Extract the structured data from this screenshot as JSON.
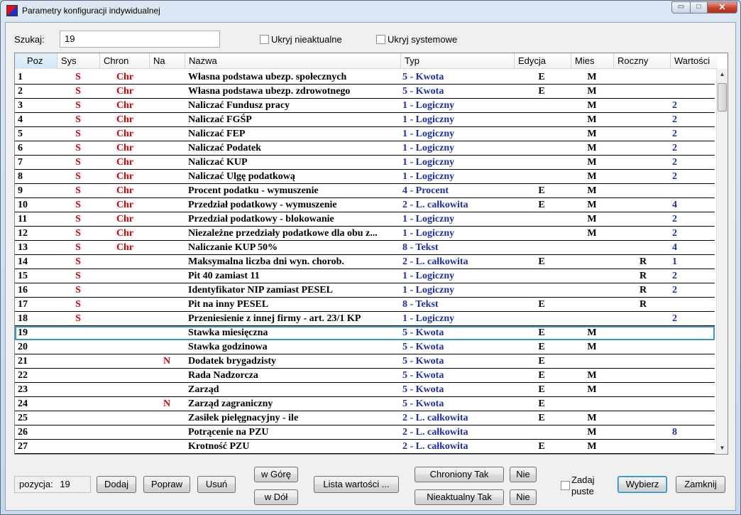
{
  "window": {
    "title": "Parametry konfiguracji indywidualnej",
    "controls": {
      "minimize": "▭",
      "maximize": "□",
      "close": "✕"
    }
  },
  "search": {
    "label": "Szukaj:",
    "value": "19"
  },
  "filters": {
    "hide_inactive": "Ukryj nieaktualne",
    "hide_system": "Ukryj systemowe"
  },
  "columns": [
    "Poz",
    "Sys",
    "Chron",
    "Na",
    "Nazwa",
    "Typ",
    "Edycja",
    "Mies",
    "Roczny",
    "Wartości"
  ],
  "rows": [
    {
      "poz": "1",
      "sys": "S",
      "chron": "Chr",
      "na": "",
      "nazwa": "Własna podstawa ubezp. społecznych",
      "typ": "5 - Kwota",
      "edycja": "E",
      "mies": "M",
      "roczny": "",
      "wart": ""
    },
    {
      "poz": "2",
      "sys": "S",
      "chron": "Chr",
      "na": "",
      "nazwa": "Własna podstawa ubezp. zdrowotnego",
      "typ": "5 - Kwota",
      "edycja": "E",
      "mies": "M",
      "roczny": "",
      "wart": ""
    },
    {
      "poz": "3",
      "sys": "S",
      "chron": "Chr",
      "na": "",
      "nazwa": "Naliczać Fundusz pracy",
      "typ": "1 - Logiczny",
      "edycja": "",
      "mies": "M",
      "roczny": "",
      "wart": "2"
    },
    {
      "poz": "4",
      "sys": "S",
      "chron": "Chr",
      "na": "",
      "nazwa": "Naliczać FGŚP",
      "typ": "1 - Logiczny",
      "edycja": "",
      "mies": "M",
      "roczny": "",
      "wart": "2"
    },
    {
      "poz": "5",
      "sys": "S",
      "chron": "Chr",
      "na": "",
      "nazwa": "Naliczać FEP",
      "typ": "1 - Logiczny",
      "edycja": "",
      "mies": "M",
      "roczny": "",
      "wart": "2"
    },
    {
      "poz": "6",
      "sys": "S",
      "chron": "Chr",
      "na": "",
      "nazwa": "Naliczać Podatek",
      "typ": "1 - Logiczny",
      "edycja": "",
      "mies": "M",
      "roczny": "",
      "wart": "2"
    },
    {
      "poz": "7",
      "sys": "S",
      "chron": "Chr",
      "na": "",
      "nazwa": "Naliczać KUP",
      "typ": "1 - Logiczny",
      "edycja": "",
      "mies": "M",
      "roczny": "",
      "wart": "2"
    },
    {
      "poz": "8",
      "sys": "S",
      "chron": "Chr",
      "na": "",
      "nazwa": "Naliczać Ulgę podatkową",
      "typ": "1 - Logiczny",
      "edycja": "",
      "mies": "M",
      "roczny": "",
      "wart": "2"
    },
    {
      "poz": "9",
      "sys": "S",
      "chron": "Chr",
      "na": "",
      "nazwa": "Procent podatku - wymuszenie",
      "typ": "4 - Procent",
      "edycja": "E",
      "mies": "M",
      "roczny": "",
      "wart": ""
    },
    {
      "poz": "10",
      "sys": "S",
      "chron": "Chr",
      "na": "",
      "nazwa": "Przedział podatkowy - wymuszenie",
      "typ": "2 - L. całkowita",
      "edycja": "E",
      "mies": "M",
      "roczny": "",
      "wart": "4"
    },
    {
      "poz": "11",
      "sys": "S",
      "chron": "Chr",
      "na": "",
      "nazwa": "Przedział podatkowy - blokowanie",
      "typ": "1 - Logiczny",
      "edycja": "",
      "mies": "M",
      "roczny": "",
      "wart": "2"
    },
    {
      "poz": "12",
      "sys": "S",
      "chron": "Chr",
      "na": "",
      "nazwa": "Niezależne przedziały podatkowe dla obu z...",
      "typ": "1 - Logiczny",
      "edycja": "",
      "mies": "M",
      "roczny": "",
      "wart": "2"
    },
    {
      "poz": "13",
      "sys": "S",
      "chron": "Chr",
      "na": "",
      "nazwa": "Naliczanie KUP 50%",
      "typ": "8 - Tekst",
      "edycja": "",
      "mies": "",
      "roczny": "",
      "wart": "4"
    },
    {
      "poz": "14",
      "sys": "S",
      "chron": "",
      "na": "",
      "nazwa": "Maksymalna liczba dni wyn. chorob.",
      "typ": "2 - L. całkowita",
      "edycja": "E",
      "mies": "",
      "roczny": "R",
      "wart": "1"
    },
    {
      "poz": "15",
      "sys": "S",
      "chron": "",
      "na": "",
      "nazwa": "Pit 40 zamiast 11",
      "typ": "1 - Logiczny",
      "edycja": "",
      "mies": "",
      "roczny": "R",
      "wart": "2"
    },
    {
      "poz": "16",
      "sys": "S",
      "chron": "",
      "na": "",
      "nazwa": "Identyfikator NIP zamiast PESEL",
      "typ": "1 - Logiczny",
      "edycja": "",
      "mies": "",
      "roczny": "R",
      "wart": "2"
    },
    {
      "poz": "17",
      "sys": "S",
      "chron": "",
      "na": "",
      "nazwa": "Pit na inny PESEL",
      "typ": "8 - Tekst",
      "edycja": "E",
      "mies": "",
      "roczny": "R",
      "wart": ""
    },
    {
      "poz": "18",
      "sys": "S",
      "chron": "",
      "na": "",
      "nazwa": "Przeniesienie z innej firmy - art. 23/1 KP",
      "typ": "1 - Logiczny",
      "edycja": "",
      "mies": "",
      "roczny": "",
      "wart": "2"
    },
    {
      "poz": "19",
      "sys": "",
      "chron": "",
      "na": "",
      "nazwa": "Stawka miesięczna",
      "typ": "5 - Kwota",
      "edycja": "E",
      "mies": "M",
      "roczny": "",
      "wart": ""
    },
    {
      "poz": "20",
      "sys": "",
      "chron": "",
      "na": "",
      "nazwa": "Stawka godzinowa",
      "typ": "5 - Kwota",
      "edycja": "E",
      "mies": "M",
      "roczny": "",
      "wart": ""
    },
    {
      "poz": "21",
      "sys": "",
      "chron": "",
      "na": "N",
      "nazwa": "Dodatek brygadzisty",
      "typ": "5 - Kwota",
      "edycja": "E",
      "mies": "",
      "roczny": "",
      "wart": ""
    },
    {
      "poz": "22",
      "sys": "",
      "chron": "",
      "na": "",
      "nazwa": "Rada Nadzorcza",
      "typ": "5 - Kwota",
      "edycja": "E",
      "mies": "M",
      "roczny": "",
      "wart": ""
    },
    {
      "poz": "23",
      "sys": "",
      "chron": "",
      "na": "",
      "nazwa": "Zarząd",
      "typ": "5 - Kwota",
      "edycja": "E",
      "mies": "M",
      "roczny": "",
      "wart": ""
    },
    {
      "poz": "24",
      "sys": "",
      "chron": "",
      "na": "N",
      "nazwa": "Zarząd zagraniczny",
      "typ": "5 - Kwota",
      "edycja": "E",
      "mies": "",
      "roczny": "",
      "wart": ""
    },
    {
      "poz": "25",
      "sys": "",
      "chron": "",
      "na": "",
      "nazwa": "Zasiłek pielęgnacyjny - ile",
      "typ": "2 - L. całkowita",
      "edycja": "E",
      "mies": "M",
      "roczny": "",
      "wart": ""
    },
    {
      "poz": "26",
      "sys": "",
      "chron": "",
      "na": "",
      "nazwa": "Potrącenie na PZU",
      "typ": "2 - L. całkowita",
      "edycja": "",
      "mies": "M",
      "roczny": "",
      "wart": "8"
    },
    {
      "poz": "27",
      "sys": "",
      "chron": "",
      "na": "",
      "nazwa": "Krotność PZU",
      "typ": "2 - L. całkowita",
      "edycja": "E",
      "mies": "M",
      "roczny": "",
      "wart": ""
    }
  ],
  "selected_row": "19",
  "footer": {
    "position_label": "pozycja:",
    "position_value": "19",
    "add": "Dodaj",
    "edit": "Popraw",
    "delete": "Usuń",
    "up": "w Górę",
    "down": "w Dół",
    "value_list": "Lista wartości ...",
    "protected_yes": "Chroniony Tak",
    "protected_no": "Nie",
    "inactive_yes": "Nieaktualny Tak",
    "inactive_no": "Nie",
    "ask_empty_line1": "Zadaj",
    "ask_empty_line2": "puste",
    "select": "Wybierz",
    "close": "Zamknij"
  }
}
